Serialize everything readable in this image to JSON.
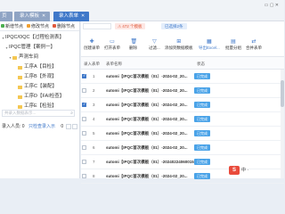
{
  "tabs": [
    {
      "label": "页"
    },
    {
      "label": "录入模板",
      "closable": true
    },
    {
      "label": "录入表单",
      "closable": true,
      "active": true
    }
  ],
  "window_controls": {
    "label": "▭ ▢ ✕"
  },
  "left_toolbar": {
    "add_node": "新增节点",
    "edit_node": "修改节点",
    "delete_node": "删除节点"
  },
  "tree": [
    {
      "label": "IPQC/OQC【过程检测表】",
      "level": 0,
      "expanded": true
    },
    {
      "label": "IPQC管理【案例一】",
      "level": 1,
      "expanded": true
    },
    {
      "label": "声测车间",
      "level": 2,
      "expanded": true
    },
    {
      "label": "工序A【目检】",
      "level": 3
    },
    {
      "label": "工序B【外观】",
      "level": 3
    },
    {
      "label": "工序C【装配】",
      "level": 3
    },
    {
      "label": "工序D【FAI检查】",
      "level": 3
    },
    {
      "label": "工序E【检验】",
      "level": 3
    }
  ],
  "left_search": {
    "placeholder": "共录入数据表示..."
  },
  "left_footer": {
    "count_label": "录入人员: 0",
    "link": "只检查录入示",
    "count2": "0"
  },
  "main_info": {
    "warn": "⚠ 472 个模板",
    "selected": "已选择2条"
  },
  "toolbar": [
    {
      "label": "创建录单",
      "icon": "plus-icon",
      "glyph": "✚"
    },
    {
      "label": "打开表单",
      "icon": "folder-icon",
      "glyph": "▭"
    },
    {
      "label": "删除",
      "icon": "trash-icon",
      "glyph": "🗑"
    },
    {
      "label": "过滤...",
      "icon": "filter-icon",
      "glyph": "▽"
    },
    {
      "label": "添加到数据模板",
      "icon": "database-icon",
      "glyph": "⊞"
    },
    {
      "label": "导出Excel...",
      "icon": "excel-icon",
      "glyph": "▦",
      "active": true
    },
    {
      "label": "批量分组",
      "icon": "group-icon",
      "glyph": "▤"
    },
    {
      "label": "合并表单",
      "icon": "merge-icon",
      "glyph": "⇄"
    }
  ],
  "grid": {
    "columns": [
      "录入表单",
      "状态",
      "表单名称"
    ],
    "rows": [
      {
        "num": "1",
        "name": "sutomi【IPQC首次模板（01）-2024-02_20...",
        "status": "已完成",
        "checked": true
      },
      {
        "num": "2",
        "name": "sutomi【IPQC首次模板（01）-2024-02_20...",
        "status": "已完成",
        "checked": false
      },
      {
        "num": "3",
        "name": "sutomi【IPQC首次模板（01）-2024-02_20...",
        "status": "已完成",
        "checked": true
      },
      {
        "num": "4",
        "name": "sutomi【IPQC首次模板（01）-2024-02_20...",
        "status": "已完成",
        "checked": false
      },
      {
        "num": "5",
        "name": "sutomi【IPQC首次模板（01）-2024-02_20...",
        "status": "已完成",
        "checked": false
      },
      {
        "num": "6",
        "name": "sutomi【IPQC首次模板（01）-2024-02_20...",
        "status": "已完成",
        "checked": false
      },
      {
        "num": "7",
        "name": "sutomi【IPQC首次模板（01）-20240224060015...",
        "status": "已完成",
        "checked": false
      },
      {
        "num": "8",
        "name": "sutomi【IPQC首次模板（01）-2024-02_20...",
        "status": "已完成",
        "checked": false
      }
    ]
  },
  "taskbar": {
    "logo": "S",
    "ime": "中 ·"
  },
  "colors": {
    "accent": "#3f78c9",
    "status_bg": "#4aa3e8",
    "warn": "#e05a3c",
    "folder": "#f4c752"
  }
}
